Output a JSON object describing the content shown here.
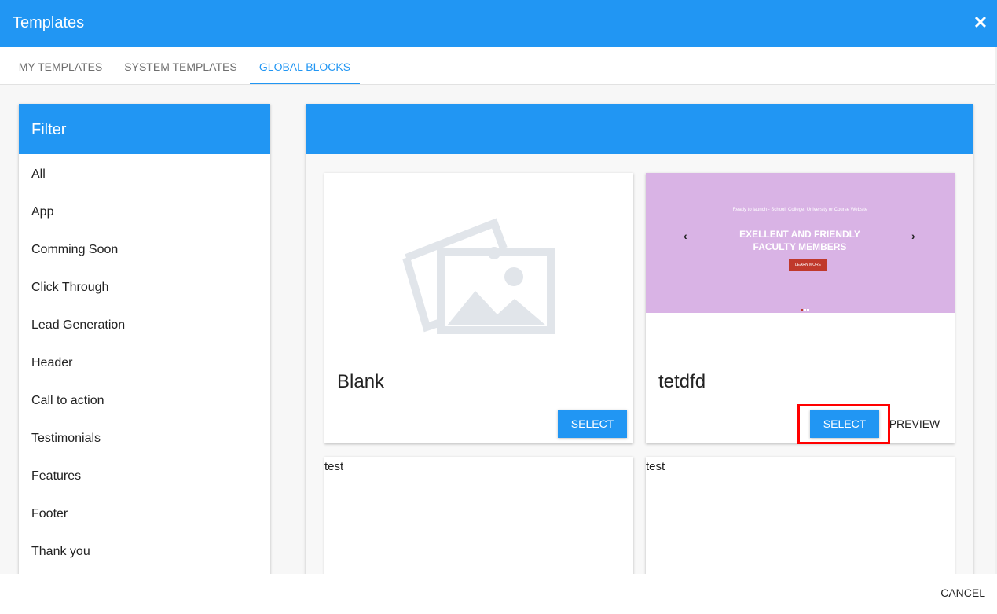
{
  "dialog": {
    "title": "Templates",
    "close_icon": "close-icon"
  },
  "tabs": [
    {
      "label": "MY TEMPLATES",
      "active": false
    },
    {
      "label": "SYSTEM TEMPLATES",
      "active": false
    },
    {
      "label": "GLOBAL BLOCKS",
      "active": true
    }
  ],
  "filter": {
    "title": "Filter",
    "items": [
      "All",
      "App",
      "Comming Soon",
      "Click Through",
      "Lead Generation",
      "Header",
      "Call to action",
      "Testimonials",
      "Features",
      "Footer",
      "Thank you"
    ]
  },
  "templates": [
    {
      "name": "Blank",
      "thumbnail": "image-placeholder-icon",
      "select_label": "SELECT"
    },
    {
      "name": "tetdfd",
      "select_label": "SELECT",
      "preview_label": "PREVIEW",
      "thumbnail_tagline": "Ready to launch - School, College, University or Course Website",
      "thumbnail_headline": "EXELLENT AND FRIENDLY FACULTY MEMBERS",
      "thumbnail_button": "LEARN MORE",
      "highlighted": true
    },
    {
      "name": "test"
    },
    {
      "name": "test"
    }
  ],
  "footer": {
    "cancel_label": "CANCEL"
  },
  "colors": {
    "primary": "#2196f3",
    "highlight": "#ff0000",
    "thumbnail_bg": "#d9b3e5"
  }
}
